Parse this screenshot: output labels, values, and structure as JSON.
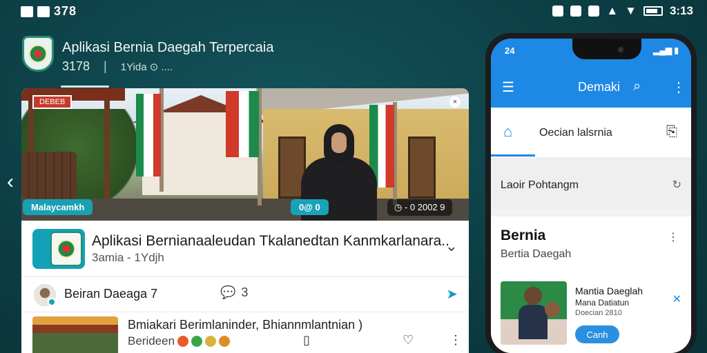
{
  "status_bar": {
    "left_number": "378",
    "time": "3:13"
  },
  "header": {
    "title": "Aplikasi Bernia Daegah Terpercaia",
    "count": "3178",
    "separator": "|",
    "meta": "1Yida ⊙ ...."
  },
  "hero": {
    "top_tag": "DEBEB",
    "tag_left": "Malaycamkh",
    "tag_mid": "0@ 0",
    "tag_right": "◷ - 0 2002 9"
  },
  "post": {
    "title": "Aplikasi Bernianaaleudan Tkalanedtan Kanmkarlanara..",
    "subtitle": "3amia - 1Ydjh",
    "author": "Beiran Daeaga 7",
    "comment_count": "3",
    "item_title": "Bmiakari Berimlaninder, Bhiannmlantnian )",
    "item_sub": "Berideen"
  },
  "colors": {
    "accent": "#1e88e5",
    "teal": "#17a3b7",
    "background": "#0c3e45"
  },
  "phone": {
    "time": "24",
    "signal": "▂▄▆ ▮",
    "app_title": "Demaki",
    "tab_label": "Oecian lalsrnia",
    "section_label": "Laoir Pohtangm",
    "card_title": "Bernia",
    "card_sub": "Bertia Daegah",
    "item_title": "Mantia Daeglah",
    "item_sub": "Mana Datiatun",
    "item_meta": "Doecian 2810",
    "button_label": "Canh"
  },
  "icons": {
    "menu": "menu-icon",
    "search": "search-icon",
    "more": "more-vertical-icon",
    "home": "home-icon",
    "refresh": "refresh-icon",
    "chevron_down": "chevron-down-icon",
    "chevron_left": "chevron-left-icon",
    "comment": "comment-icon",
    "share": "share-icon",
    "bookmark": "bookmark-icon",
    "heart": "heart-icon",
    "close": "close-icon"
  }
}
